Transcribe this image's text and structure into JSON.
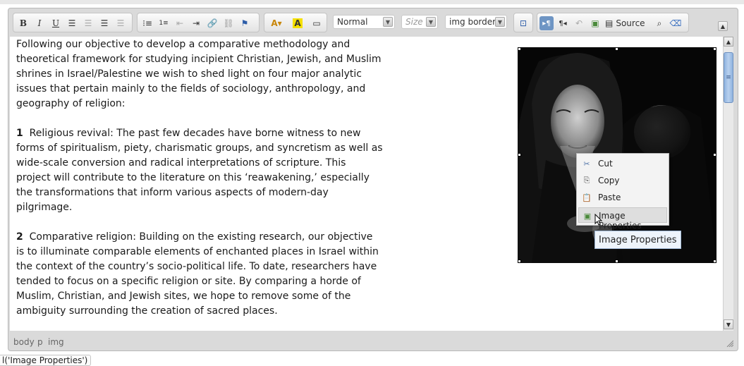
{
  "toolbar": {
    "bold": "B",
    "italic": "I",
    "underline": "U",
    "format_value": "Normal",
    "size_value": "Size",
    "style_value": "img border",
    "source_label": "Source"
  },
  "content": {
    "paragraphs": [
      {
        "num": "",
        "text": "Following our objective to develop a comparative methodology and theoretical framework for studying incipient Christian, Jewish, and Muslim shrines in Israel/Palestine we wish to shed light on four major analytic issues that pertain mainly to the fields of sociology, anthropology, and geography of religion:"
      },
      {
        "num": "1",
        "text": "Religious revival: The past few decades have borne witness to new forms of spiritualism, piety, charismatic groups, and syncretism as well as wide-scale conversion and radical interpretations of scripture. This project will contribute to the literature on this ‘reawakening,’ especially the transformations that inform various aspects of modern-day pilgrimage."
      },
      {
        "num": "2",
        "text": "Comparative religion: Building on the existing research, our objective is to illuminate comparable elements of enchanted places in Israel within the context of the country’s socio-political life. To date, researchers have tended to focus on a specific religion or site. By comparing a horde of Muslim, Christian, and Jewish sites, we hope to remove some of the ambiguity surrounding the creation of sacred places."
      }
    ]
  },
  "context_menu": {
    "items": [
      {
        "label": "Cut",
        "icon": "scissors-icon"
      },
      {
        "label": "Copy",
        "icon": "copy-icon"
      },
      {
        "label": "Paste",
        "icon": "paste-icon"
      },
      {
        "label": "Image Properties",
        "icon": "image-icon"
      }
    ]
  },
  "tooltip": "Image Properties",
  "status": {
    "path": [
      "body",
      "p",
      "img"
    ]
  },
  "bottom_tip": "l('Image Properties')",
  "colors": {
    "accent": "#6e95c4",
    "editor_frame": "#dadada",
    "scroll_thumb": "#8fb3df"
  }
}
